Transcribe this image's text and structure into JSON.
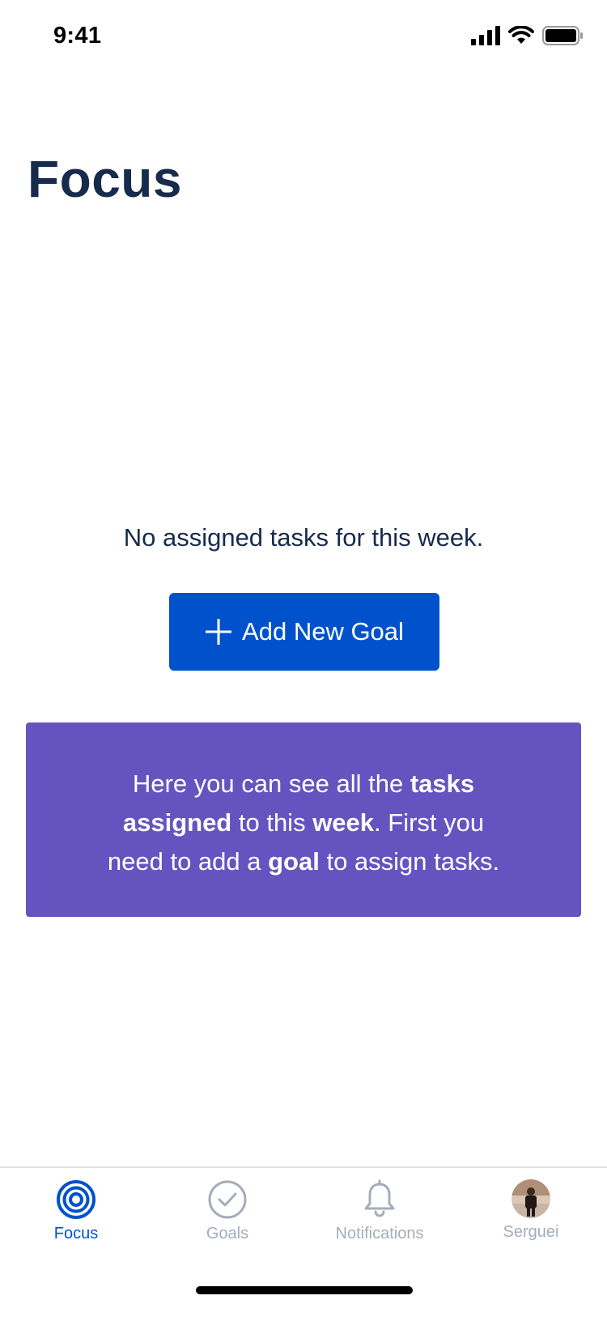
{
  "status_bar": {
    "time": "9:41"
  },
  "page": {
    "title": "Focus"
  },
  "empty_state": {
    "message": "No assigned tasks for this week.",
    "button_label": "Add New Goal"
  },
  "info_card": {
    "line1_pre": "Here you can see all the ",
    "line1_bold": "tasks",
    "line2_bold": "assigned",
    "line2_mid": " to this ",
    "line2_bold2": "week",
    "line2_post": ". First you",
    "line3_pre": "need to add a ",
    "line3_bold": "goal",
    "line3_post": " to assign tasks."
  },
  "tab_bar": {
    "items": [
      {
        "label": "Focus",
        "icon": "target-icon",
        "active": true
      },
      {
        "label": "Goals",
        "icon": "check-circle-icon",
        "active": false
      },
      {
        "label": "Notifications",
        "icon": "bell-icon",
        "active": false
      },
      {
        "label": "Serguei",
        "icon": "avatar",
        "active": false
      }
    ]
  },
  "colors": {
    "primary": "#0052CC",
    "card": "#6554C0",
    "title": "#172B4D",
    "inactive_tab": "#A5ADBA"
  }
}
